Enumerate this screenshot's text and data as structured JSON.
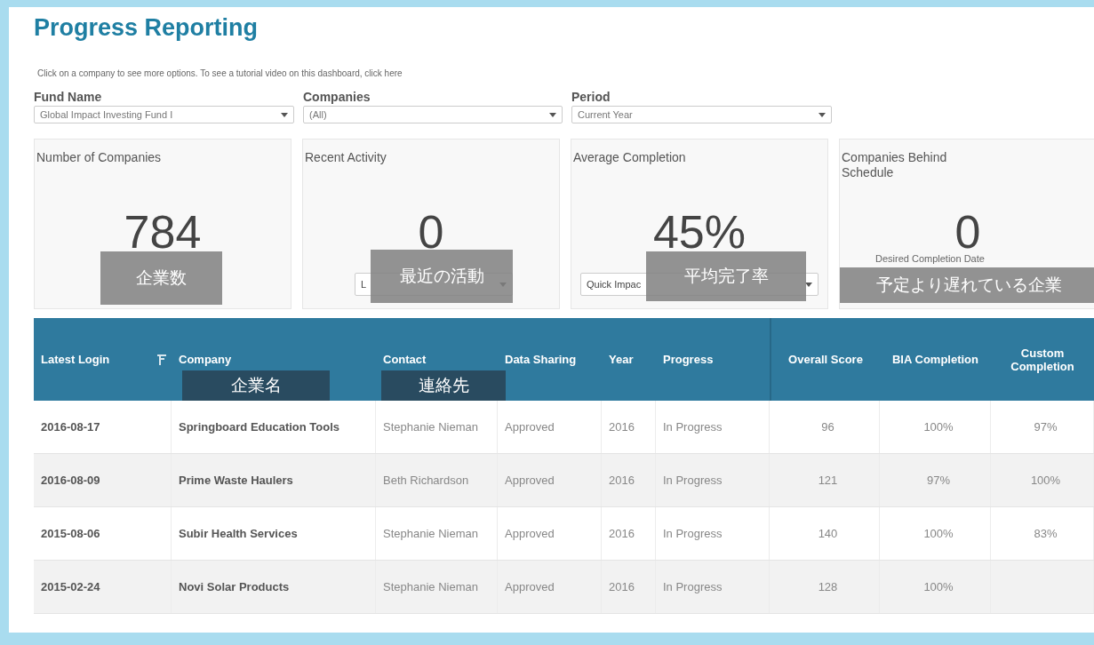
{
  "title": "Progress Reporting",
  "instructions": "Click on a company to see more options. To see a tutorial video on this dashboard, click here",
  "filters": [
    {
      "label": "Fund Name",
      "value": "Global Impact Investing Fund I"
    },
    {
      "label": "Companies",
      "value": "(All)"
    },
    {
      "label": "Period",
      "value": "Current Year"
    }
  ],
  "cards": [
    {
      "title": "Number of Companies",
      "value": "784",
      "caption": "企業数"
    },
    {
      "title": "Recent Activity",
      "value": "0",
      "dropdown": "L",
      "caption": "最近の活動"
    },
    {
      "title": "Average Completion",
      "value": "45%",
      "dropdown": "Quick Impac",
      "caption": "平均完了率"
    },
    {
      "title": "Companies Behind Schedule",
      "value": "0",
      "dropdown_label": "Desired Completion Date",
      "caption": "予定より遅れている企業"
    }
  ],
  "table": {
    "columns": [
      {
        "label": "Latest Login"
      },
      {
        "label": "Company",
        "caption": "企業名"
      },
      {
        "label": "Contact",
        "caption": "連絡先"
      },
      {
        "label": "Data Sharing"
      },
      {
        "label": "Year"
      },
      {
        "label": "Progress"
      },
      {
        "label": "Overall Score"
      },
      {
        "label": "BIA Completion"
      },
      {
        "label": "Custom Completion"
      }
    ],
    "rows": [
      [
        "2016-08-17",
        "Springboard Education Tools",
        "Stephanie Nieman",
        "Approved",
        "2016",
        "In Progress",
        "96",
        "100%",
        "97%"
      ],
      [
        "2016-08-09",
        "Prime Waste Haulers",
        "Beth Richardson",
        "Approved",
        "2016",
        "In Progress",
        "121",
        "97%",
        "100%"
      ],
      [
        "2015-08-06",
        "Subir Health Services",
        "Stephanie Nieman",
        "Approved",
        "2016",
        "In Progress",
        "140",
        "100%",
        "83%"
      ],
      [
        "2015-02-24",
        "Novi Solar Products",
        "Stephanie Nieman",
        "Approved",
        "2016",
        "In Progress",
        "128",
        "100%"
      ]
    ]
  }
}
